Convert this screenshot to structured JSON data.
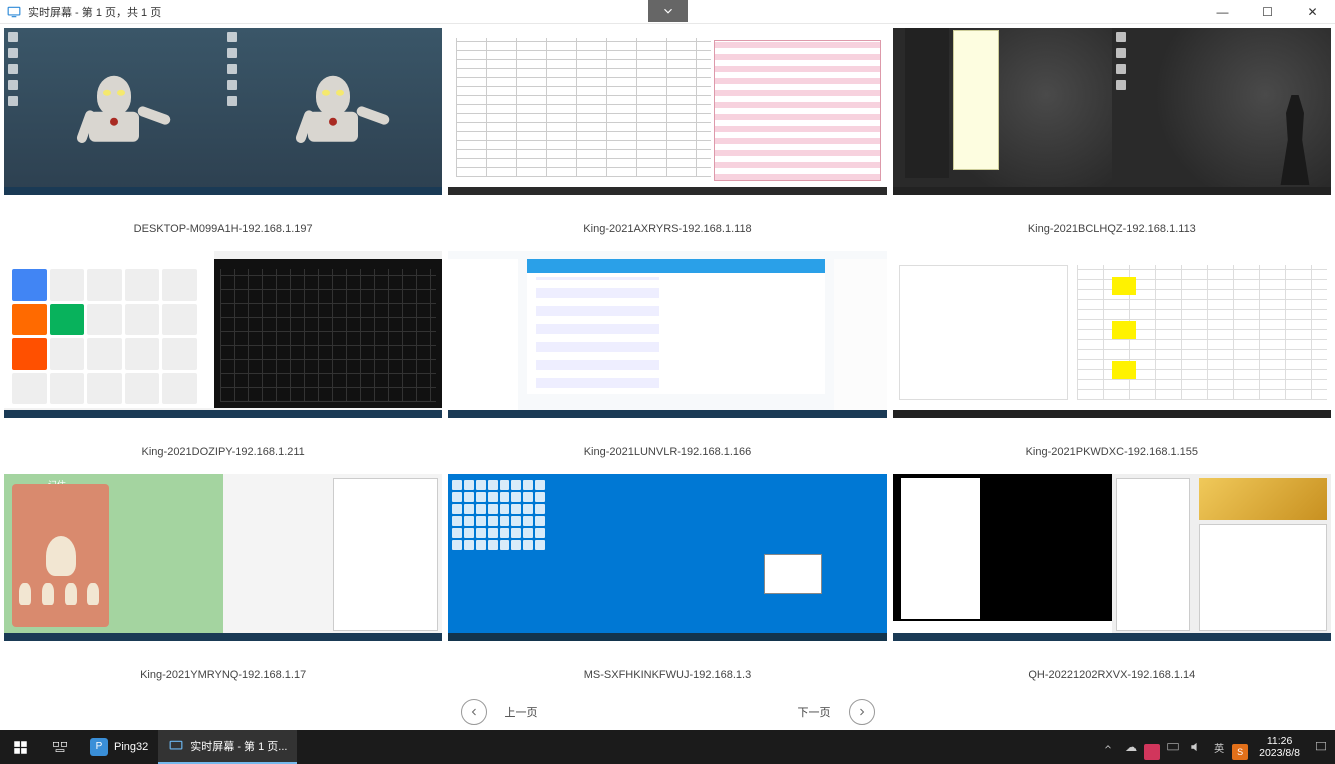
{
  "titlebar": {
    "title": "实时屏幕 - 第 1 页，共 1 页",
    "collapse_icon": "chevron-down"
  },
  "window_controls": {
    "minimize": "—",
    "maximize": "☐",
    "close": "✕"
  },
  "monk_text": "记住",
  "screens": [
    {
      "label": "DESKTOP-M099A1H-192.168.1.197"
    },
    {
      "label": "King-2021AXRYRS-192.168.1.118"
    },
    {
      "label": "King-2021BCLHQZ-192.168.1.113"
    },
    {
      "label": "King-2021DOZIPY-192.168.1.211"
    },
    {
      "label": "King-2021LUNVLR-192.168.1.166"
    },
    {
      "label": "King-2021PKWDXC-192.168.1.155"
    },
    {
      "label": "King-2021YMRYNQ-192.168.1.17"
    },
    {
      "label": "MS-SXFHKINKFWUJ-192.168.1.3"
    },
    {
      "label": "QH-20221202RXVX-192.168.1.14"
    }
  ],
  "pager": {
    "prev": "上一页",
    "next": "下一页"
  },
  "taskbar": {
    "app1": "Ping32",
    "app2": "实时屏幕 - 第 1 页...",
    "ime": "英",
    "clock_time": "11:26",
    "clock_date": "2023/8/8"
  }
}
